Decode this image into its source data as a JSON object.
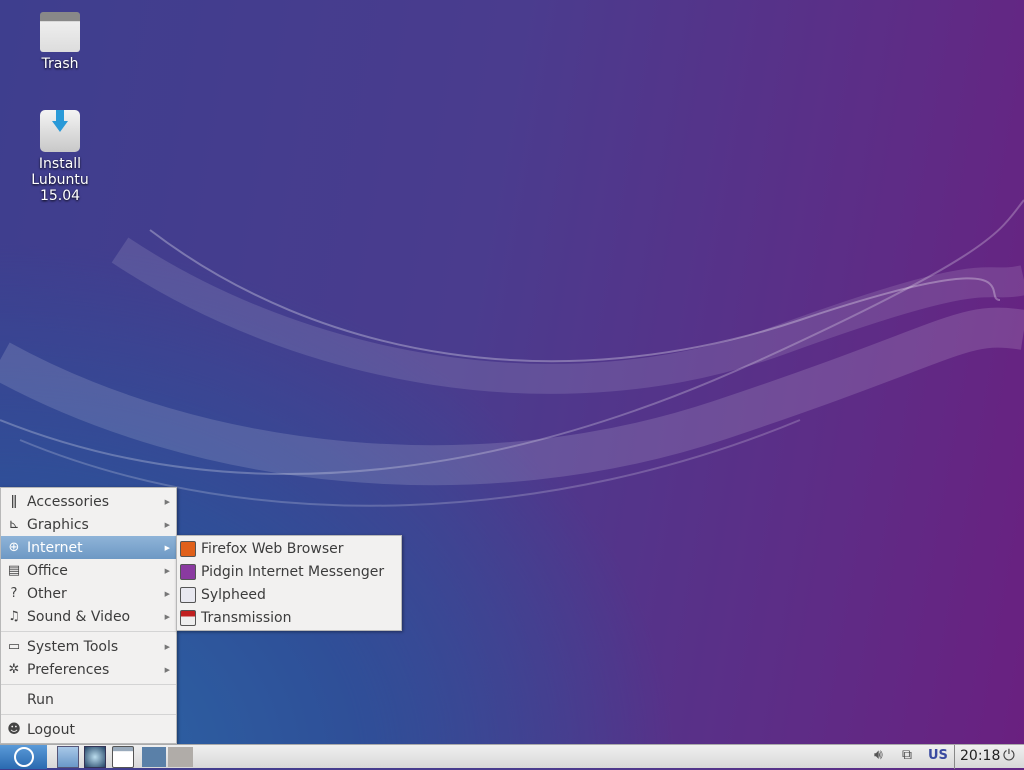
{
  "desktop": {
    "icons": [
      {
        "label": "Trash",
        "icon": "trash-icon"
      },
      {
        "label": "Install Lubuntu 15.04",
        "icon": "installer-icon"
      }
    ]
  },
  "menu": {
    "items": [
      {
        "label": "Accessories",
        "icon": "accessories-icon",
        "submenu": true
      },
      {
        "label": "Graphics",
        "icon": "graphics-icon",
        "submenu": true
      },
      {
        "label": "Internet",
        "icon": "internet-icon",
        "submenu": true,
        "selected": true
      },
      {
        "label": "Office",
        "icon": "office-icon",
        "submenu": true
      },
      {
        "label": "Other",
        "icon": "other-icon",
        "submenu": true
      },
      {
        "label": "Sound & Video",
        "icon": "sound-video-icon",
        "submenu": true
      },
      {
        "label": "System Tools",
        "icon": "system-tools-icon",
        "submenu": true
      },
      {
        "label": "Preferences",
        "icon": "preferences-icon",
        "submenu": true
      },
      {
        "label": "Run",
        "icon": ""
      },
      {
        "label": "Logout",
        "icon": "logout-icon"
      }
    ]
  },
  "submenu": {
    "items": [
      {
        "label": "Firefox Web Browser",
        "icon": "firefox-icon",
        "color": "#e0601a"
      },
      {
        "label": "Pidgin Internet Messenger",
        "icon": "pidgin-icon",
        "color": "#8a3aa0"
      },
      {
        "label": "Sylpheed",
        "icon": "sylpheed-icon",
        "color": "#e8e8f0"
      },
      {
        "label": "Transmission",
        "icon": "transmission-icon",
        "color": "#c02020"
      }
    ]
  },
  "taskbar": {
    "keyboard_layout": "US",
    "clock": "20:18",
    "workspaces": [
      {
        "active": true
      },
      {
        "active": false
      }
    ]
  }
}
